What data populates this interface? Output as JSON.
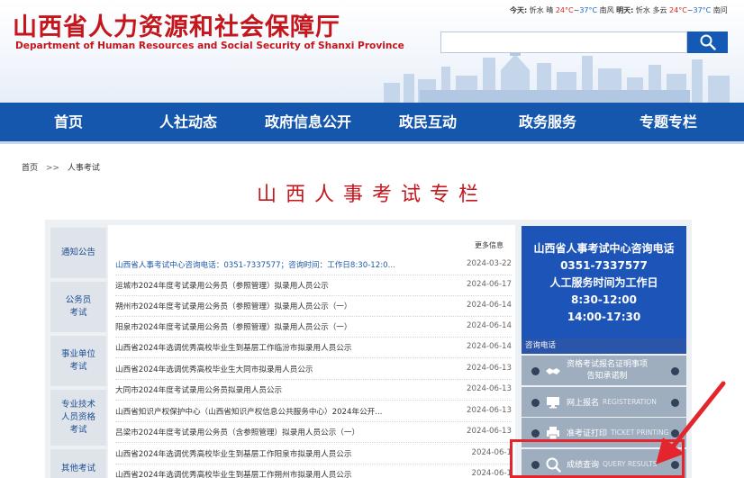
{
  "header": {
    "title_cn": "山西省人力资源和社会保障厅",
    "title_en": "Department of Human Resources and Social Security of Shanxi Province",
    "weather": {
      "today_label": "今天:",
      "today_city": "忻水 晴",
      "today_high": "24°C",
      "today_sep": "~",
      "today_low": "37°C",
      "today_wind": "南风",
      "tomorrow_label": "明天:",
      "tomorrow_city": "忻水 多云",
      "tomorrow_high": "24°C",
      "tomorrow_sep": "~",
      "tomorrow_low": "37°C",
      "tomorrow_wind": "南问"
    },
    "search": {
      "value": ""
    }
  },
  "nav": {
    "items": [
      {
        "label": "首页"
      },
      {
        "label": "人社动态"
      },
      {
        "label": "政府信息公开"
      },
      {
        "label": "政民互动"
      },
      {
        "label": "政务服务"
      },
      {
        "label": "专题专栏"
      }
    ]
  },
  "breadcrumb": {
    "home": "首页",
    "sep": ">>",
    "current": "人事考试"
  },
  "page_title": "山西人事考试专栏",
  "sidebar": {
    "tabs": [
      {
        "label": "通知公告"
      },
      {
        "label": "公务员考试"
      },
      {
        "label": "事业单位考试"
      },
      {
        "label": "专业技术人员资格考试"
      },
      {
        "label": "其他考试"
      }
    ]
  },
  "list": {
    "more_label": "更多信息",
    "rows": [
      {
        "title": "山西省人事考试中心咨询电话：0351-7337577；咨询时间：工作日8:30-12:0...",
        "date": "2024-03-22"
      },
      {
        "title": "运城市2024年度考试录用公务员（参照管理）拟录用人员公示",
        "date": "2024-06-17"
      },
      {
        "title": "朔州市2024年度考试录用公务员（参照管理）拟录用人员公示（一）",
        "date": "2024-06-14"
      },
      {
        "title": "阳泉市2024年度考试录用公务员（参照管理）拟录用人员公示（一）",
        "date": "2024-06-14"
      },
      {
        "title": "山西省2024年选调优秀高校毕业生到基层工作临汾市拟录用人员公示",
        "date": "2024-06-14"
      },
      {
        "title": "山西省2024年选调优秀高校毕业生大同市拟录用人员公示",
        "date": "2024-06-13"
      },
      {
        "title": "大同市2024年度考试录用公务员拟录用人员公示",
        "date": "2024-06-13"
      },
      {
        "title": "山西省知识产权保护中心（山西省知识产权信息公共服务中心）2024年公开...",
        "date": "2024-06-13"
      },
      {
        "title": "吕梁市2024年度考试录用公务员（含参照管理）拟录用人员公示（一）",
        "date": "2024-06-13"
      },
      {
        "title": "山西省2024年选调优秀高校毕业生到基层工作阳泉市拟录用人员公示",
        "date": "2024-06-1"
      },
      {
        "title": "山西省2024年选调优秀高校毕业生到基层工作朔州市拟录用人员公示",
        "date": "2024-06-1"
      }
    ]
  },
  "hotline": {
    "line1": "山西省人事考试中心咨询电话",
    "line2": "0351-7337577",
    "line3": "人工服务时间为工作日",
    "line4": "8:30-12:00",
    "line5": "14:00-17:30"
  },
  "consult_label": "咨询电话",
  "services": [
    {
      "cn": "资格考试报名证明事项",
      "cn2": "告知承诺制",
      "en": "",
      "icon": "handshake-icon"
    },
    {
      "cn": "网上报名",
      "en": "REGISTERATION",
      "icon": "monitor-icon"
    },
    {
      "cn": "准考证打印",
      "en": "TICKET PRINTING",
      "icon": "printer-icon"
    },
    {
      "cn": "成绩查询",
      "en": "QUERY RESULTS",
      "icon": "magnifier-icon"
    }
  ],
  "colors": {
    "brand_red": "#c4161c",
    "nav_blue": "#1457ad",
    "highlight": "#e5252d"
  }
}
